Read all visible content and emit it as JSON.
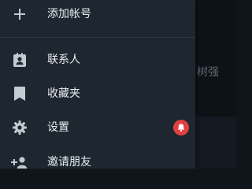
{
  "drawer": {
    "items": [
      {
        "label": "添加帐号",
        "icon": "plus-icon"
      },
      {
        "label": "联系人",
        "icon": "contact-book-icon"
      },
      {
        "label": "收藏夹",
        "icon": "bookmark-icon"
      },
      {
        "label": "设置",
        "icon": "gear-icon",
        "badge_icon": "bell-icon"
      },
      {
        "label": "邀请朋友",
        "icon": "add-person-icon"
      }
    ]
  },
  "background": {
    "peek_text": "树强"
  },
  "colors": {
    "drawer_bg": "#1e2730",
    "badge": "#e0403f",
    "icon": "#c3cad1",
    "text": "#e8ecf0"
  }
}
